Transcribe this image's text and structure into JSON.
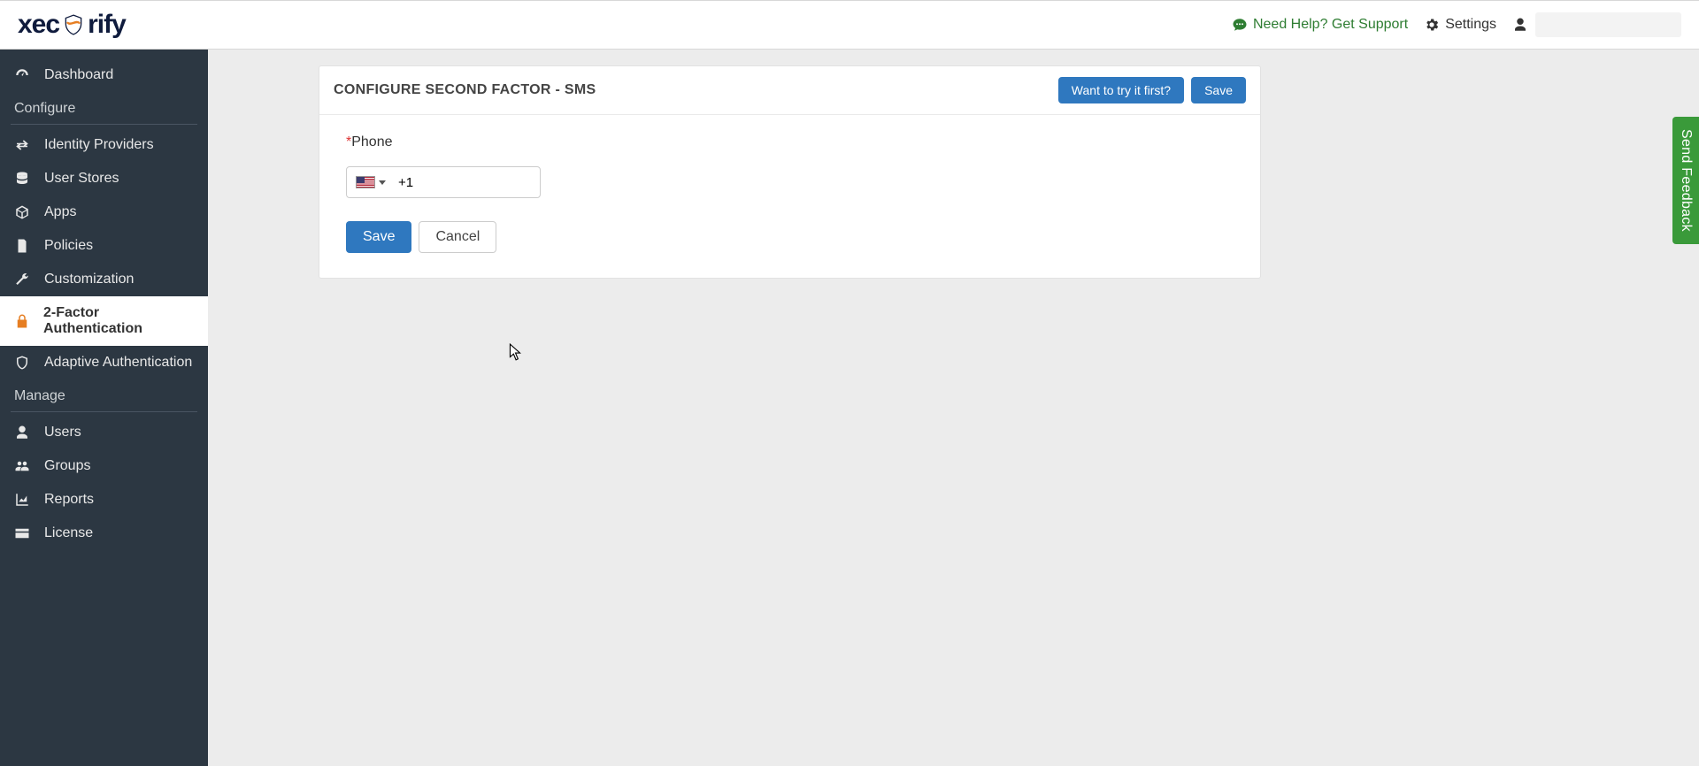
{
  "header": {
    "logo_part1": "xec",
    "logo_part2": "rify",
    "support_label": "Need Help? Get Support",
    "settings_label": "Settings"
  },
  "sidebar": {
    "items": [
      {
        "label": "Dashboard"
      }
    ],
    "section_configure": "Configure",
    "configure_items": [
      {
        "label": "Identity Providers"
      },
      {
        "label": "User Stores"
      },
      {
        "label": "Apps"
      },
      {
        "label": "Policies"
      },
      {
        "label": "Customization"
      },
      {
        "label": "2-Factor Authentication"
      },
      {
        "label": "Adaptive Authentication"
      }
    ],
    "section_manage": "Manage",
    "manage_items": [
      {
        "label": "Users"
      },
      {
        "label": "Groups"
      },
      {
        "label": "Reports"
      },
      {
        "label": "License"
      }
    ]
  },
  "panel": {
    "title": "CONFIGURE SECOND FACTOR - SMS",
    "try_label": "Want to try it first?",
    "save_top_label": "Save",
    "phone_label": "Phone",
    "phone_required": "*",
    "phone_prefix": "+1",
    "save_label": "Save",
    "cancel_label": "Cancel"
  },
  "feedback_label": "Send Feedback",
  "colors": {
    "sidebar_bg": "#2c3742",
    "primary": "#2f78bf",
    "feedback": "#3a9a3a",
    "support": "#2e7d32",
    "active_icon": "#e67e22"
  }
}
